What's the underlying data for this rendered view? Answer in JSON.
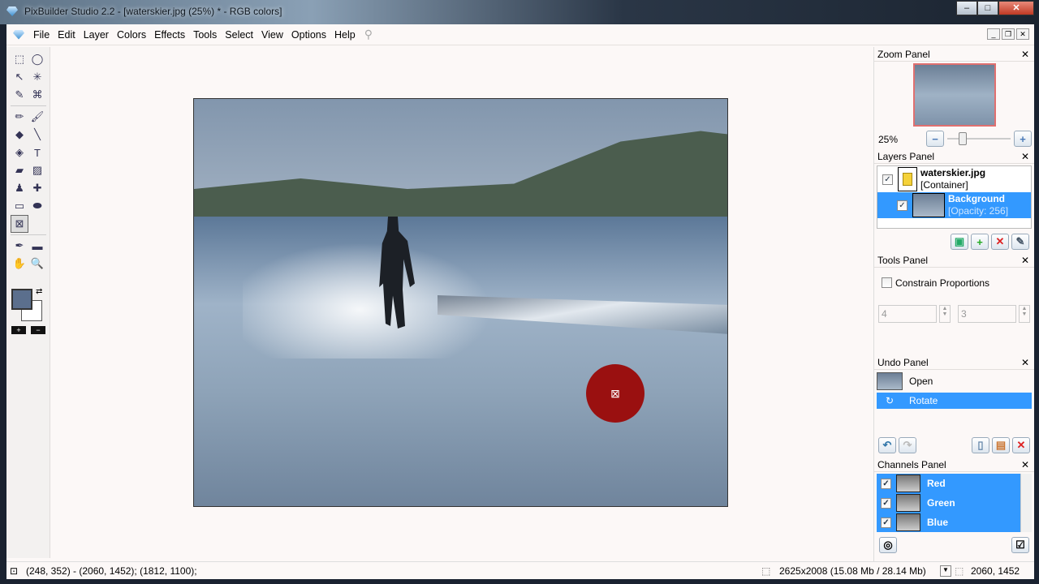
{
  "window": {
    "title": "PixBuilder Studio 2.2 - [waterskier.jpg (25%) * - RGB colors]",
    "min": "–",
    "max": "□",
    "close": "✕"
  },
  "menu": [
    "File",
    "Edit",
    "Layer",
    "Colors",
    "Effects",
    "Tools",
    "Select",
    "View",
    "Options",
    "Help"
  ],
  "mdi": {
    "min": "_",
    "restore": "❐",
    "close": "✕"
  },
  "tools": [
    [
      "⬚",
      "◯"
    ],
    [
      "↖",
      "✳"
    ],
    [
      "✎",
      "⌘"
    ],
    [
      "✏",
      "🖌"
    ],
    [
      "◆",
      "╲"
    ],
    [
      "◈",
      "T"
    ],
    [
      "▰",
      "▨"
    ],
    [
      "♟",
      "✚"
    ],
    [
      "▭",
      "⬬"
    ],
    [
      "⊠",
      ""
    ],
    [
      "✒",
      "▬"
    ],
    [
      "✋",
      "🔍"
    ]
  ],
  "zoom_panel": {
    "title": "Zoom Panel",
    "value": "25%",
    "minus": "−",
    "plus": "+",
    "slider_fraction": 0.2
  },
  "layers_panel": {
    "title": "Layers Panel",
    "layers": [
      {
        "name": "waterskier.jpg",
        "sub": "[Container]"
      },
      {
        "name": "Background",
        "sub": "[Opacity: 256]"
      }
    ]
  },
  "tools_panel": {
    "title": "Tools Panel",
    "constrain": "Constrain Proportions",
    "w": "4",
    "h": "3"
  },
  "undo_panel": {
    "title": "Undo Panel",
    "items": [
      "Open",
      "Rotate"
    ]
  },
  "channels_panel": {
    "title": "Channels Panel",
    "items": [
      "Red",
      "Green",
      "Blue"
    ]
  },
  "status": {
    "coords": "(248, 352) - (2060, 1452);  (1812, 1100);",
    "size": "2625x2008  (15.08 Mb / 28.14 Mb)",
    "pos": "2060, 1452"
  },
  "close_x": "✕"
}
